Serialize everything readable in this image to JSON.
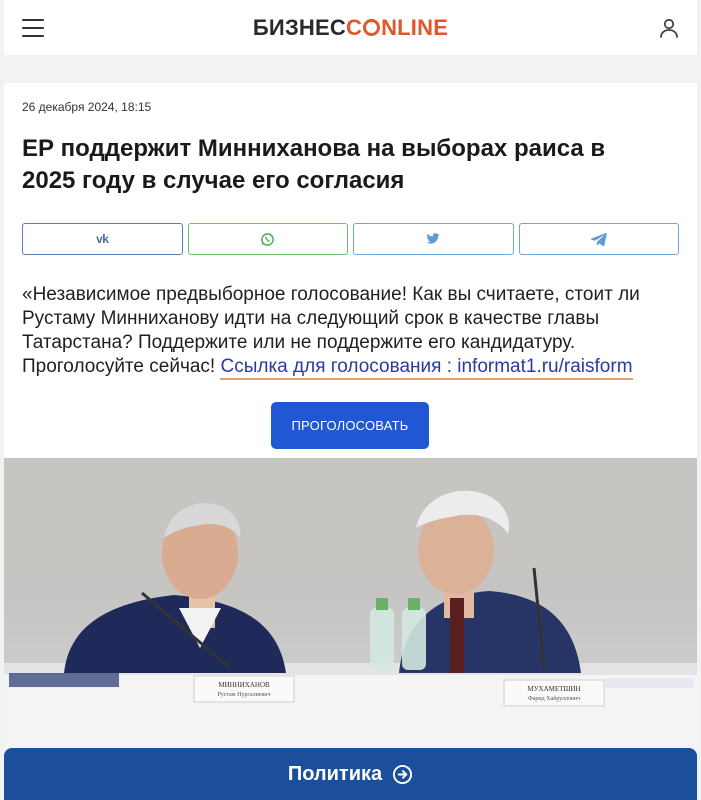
{
  "header": {
    "logo_part1": "БИЗНЕС",
    "logo_part2": "NLINE",
    "menu_icon": "hamburger-menu-icon",
    "profile_icon": "user-icon"
  },
  "article": {
    "date": "26 декабря 2024, 18:15",
    "title": "ЕР поддержит Минниханова на выборах раиса в 2025 году в случае его согласия",
    "share": [
      {
        "name": "vk",
        "icon": "vk-icon",
        "label": "vk"
      },
      {
        "name": "whatsapp",
        "icon": "whatsapp-icon"
      },
      {
        "name": "twitter",
        "icon": "twitter-icon"
      },
      {
        "name": "telegram",
        "icon": "telegram-icon"
      }
    ],
    "quote_text": "«Независимое предвыборное голосование! Как вы считаете, стоит ли Рустаму Минниханову идти на следующий срок в качестве главы Татарстана? Поддержите или не поддержите его кандидатуру. Проголосуйте сейчас! ",
    "quote_link": "Ссылка для голосования : informat1.ru/raisform",
    "vote_button": "ПРОГОЛОСОВАТЬ",
    "photo_placards": [
      "МИННИХАНОВ",
      "Рустам Нургалиевич",
      "МУХАМЕТШИН",
      "Фарид Хайруллович"
    ]
  },
  "rubric": {
    "label": "Политика",
    "icon": "arrow-circle-right-icon"
  },
  "colors": {
    "accent": "#e3562b",
    "vote_button": "#1f58d2",
    "rubric_bar": "#1c4f9b",
    "link": "#2b3aa0"
  }
}
